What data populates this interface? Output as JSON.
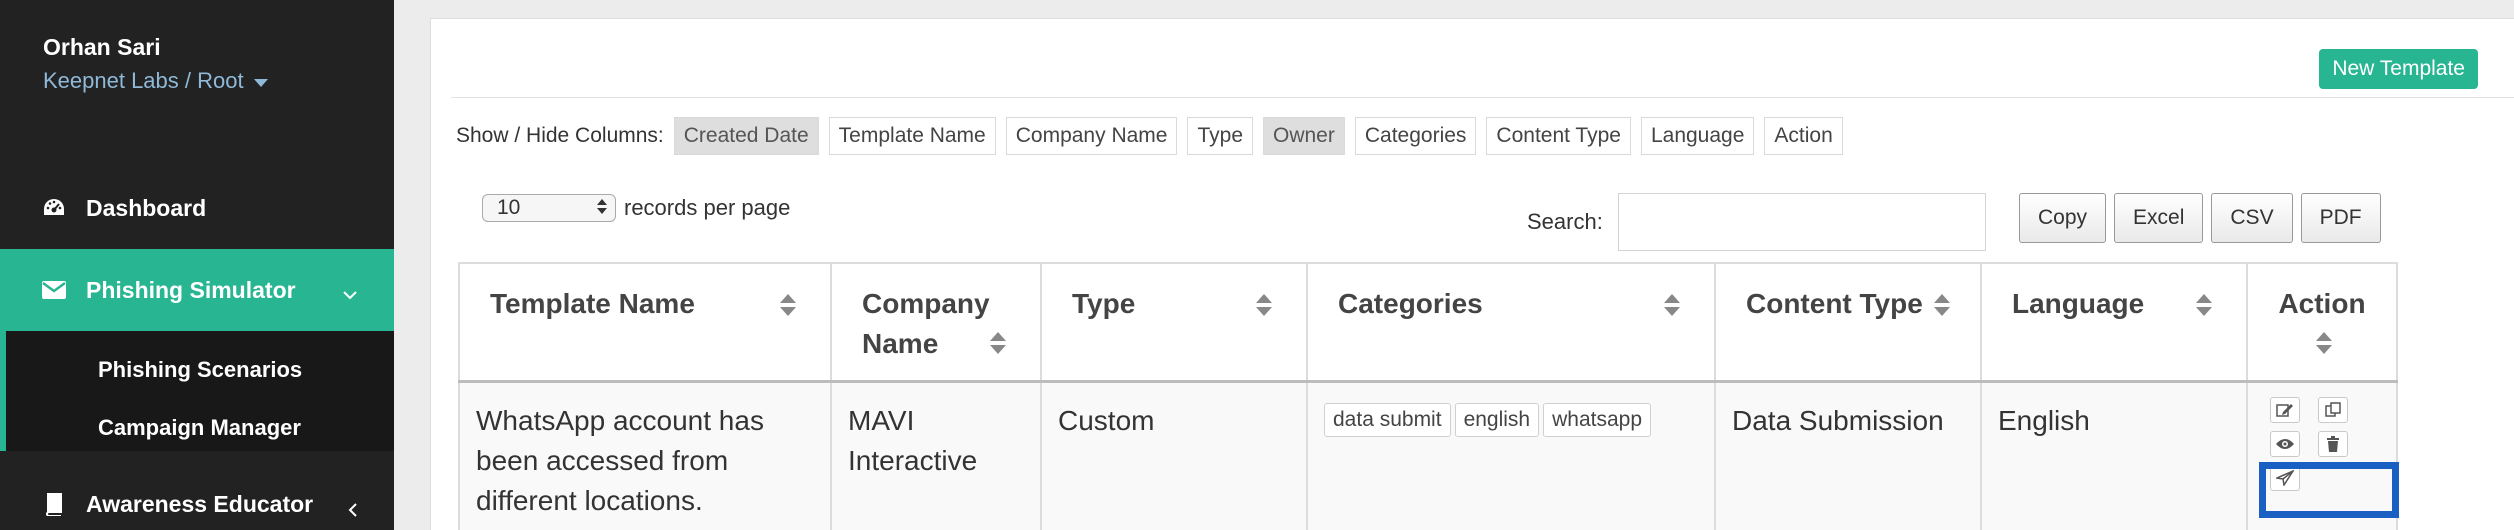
{
  "sidebar": {
    "user_name": "Orhan Sari",
    "org_path": "Keepnet Labs / Root",
    "items": [
      {
        "label": "Dashboard",
        "icon": "dashboard-icon"
      },
      {
        "label": "Phishing Simulator",
        "icon": "envelope-icon",
        "active": true
      },
      {
        "label": "Awareness Educator",
        "icon": "book-icon"
      }
    ],
    "sub_items": [
      {
        "label": "Phishing Scenarios"
      },
      {
        "label": "Campaign Manager"
      }
    ]
  },
  "toolbar": {
    "new_template_label": "New Template",
    "show_hide_label": "Show / Hide Columns:",
    "column_toggles": [
      {
        "label": "Created Date",
        "visible": false
      },
      {
        "label": "Template Name",
        "visible": true
      },
      {
        "label": "Company Name",
        "visible": true
      },
      {
        "label": "Type",
        "visible": true
      },
      {
        "label": "Owner",
        "visible": false
      },
      {
        "label": "Categories",
        "visible": true
      },
      {
        "label": "Content Type",
        "visible": true
      },
      {
        "label": "Language",
        "visible": true
      },
      {
        "label": "Action",
        "visible": true
      }
    ],
    "records_value": "10",
    "records_label": "records per page",
    "search_label": "Search:",
    "search_value": "",
    "export_buttons": [
      "Copy",
      "Excel",
      "CSV",
      "PDF"
    ]
  },
  "table": {
    "headers": {
      "template_name": "Template Name",
      "company_name": "Company Name",
      "type": "Type",
      "categories": "Categories",
      "content_type": "Content Type",
      "language": "Language",
      "action": "Action"
    },
    "rows": [
      {
        "template_name": "WhatsApp account has been accessed from different locations.",
        "company_name": "MAVI Interactive",
        "type": "Custom",
        "categories": [
          "data submit",
          "english",
          "whatsapp"
        ],
        "content_type": "Data Submission",
        "language": "English",
        "actions": [
          "edit-icon",
          "copy-icon",
          "view-icon",
          "trash-icon",
          "send-icon"
        ]
      }
    ]
  },
  "colors": {
    "accent": "#27b592",
    "sidebar_bg": "#222222",
    "highlight": "#1a5fc2"
  }
}
